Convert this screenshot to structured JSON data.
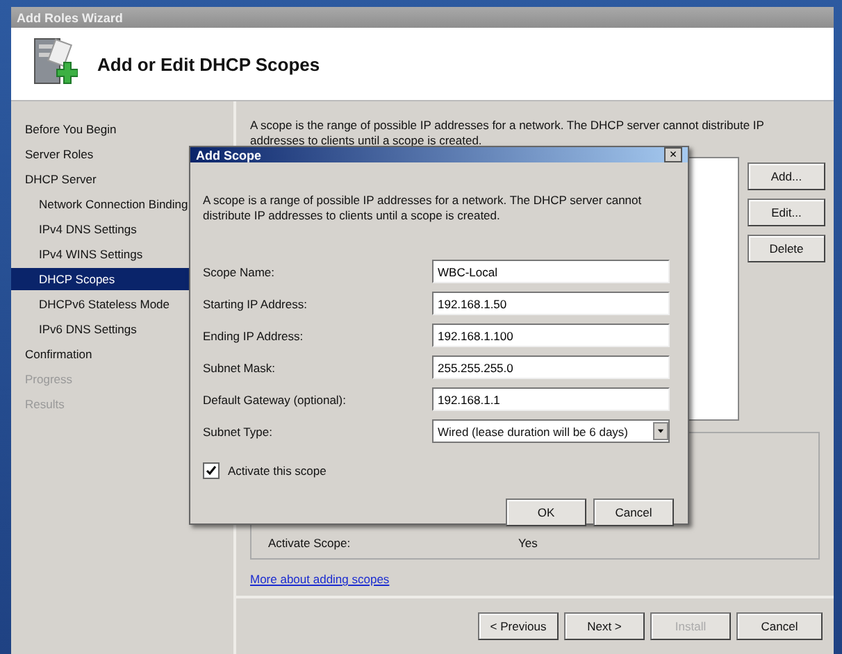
{
  "window": {
    "title": "Add Roles Wizard"
  },
  "header": {
    "title": "Add or Edit DHCP Scopes"
  },
  "sidebar": {
    "items": [
      {
        "label": "Before You Begin",
        "selected": false,
        "disabled": false
      },
      {
        "label": "Server Roles",
        "selected": false,
        "disabled": false
      },
      {
        "label": "DHCP Server",
        "selected": false,
        "disabled": false,
        "children": [
          {
            "label": "Network Connection Binding",
            "selected": false,
            "disabled": false
          },
          {
            "label": "IPv4 DNS Settings",
            "selected": false,
            "disabled": false
          },
          {
            "label": "IPv4 WINS Settings",
            "selected": false,
            "disabled": false
          },
          {
            "label": "DHCP Scopes",
            "selected": true,
            "disabled": false
          },
          {
            "label": "DHCPv6 Stateless Mode",
            "selected": false,
            "disabled": false
          },
          {
            "label": "IPv6 DNS Settings",
            "selected": false,
            "disabled": false
          }
        ]
      },
      {
        "label": "Confirmation",
        "selected": false,
        "disabled": false
      },
      {
        "label": "Progress",
        "selected": false,
        "disabled": true
      },
      {
        "label": "Results",
        "selected": false,
        "disabled": true
      }
    ]
  },
  "content": {
    "description": "A scope is the range of possible IP addresses for a network. The DHCP server cannot distribute IP addresses to clients until a scope is created.",
    "side_buttons": [
      {
        "label": "Add..."
      },
      {
        "label": "Edit..."
      },
      {
        "label": "Delete"
      }
    ],
    "properties": [
      {
        "label": "Activate Scope:",
        "value": "Yes"
      }
    ],
    "link": "More about adding scopes"
  },
  "footer": {
    "buttons": [
      {
        "label": "< Previous",
        "disabled": false
      },
      {
        "label": "Next >",
        "disabled": false
      },
      {
        "label": "Install",
        "disabled": true
      },
      {
        "label": "Cancel",
        "disabled": false
      }
    ]
  },
  "dialog": {
    "title": "Add Scope",
    "close": "×",
    "description": "A scope is a range of possible IP addresses for a network. The DHCP server cannot distribute IP addresses to clients until a scope is created.",
    "fields": [
      {
        "label": "Scope Name:",
        "value": "WBC-Local",
        "kind": "text"
      },
      {
        "label": "Starting IP Address:",
        "value": "192.168.1.50",
        "kind": "text"
      },
      {
        "label": "Ending IP Address:",
        "value": "192.168.1.100",
        "kind": "text"
      },
      {
        "label": "Subnet Mask:",
        "value": "255.255.255.0",
        "kind": "text"
      },
      {
        "label": "Default Gateway (optional):",
        "value": "192.168.1.1",
        "kind": "text"
      },
      {
        "label": "Subnet Type:",
        "value": "Wired (lease duration will be 6 days)",
        "kind": "dropdown"
      }
    ],
    "checkbox": {
      "label": "Activate this scope",
      "checked": true
    },
    "buttons": [
      {
        "label": "OK"
      },
      {
        "label": "Cancel"
      }
    ]
  }
}
